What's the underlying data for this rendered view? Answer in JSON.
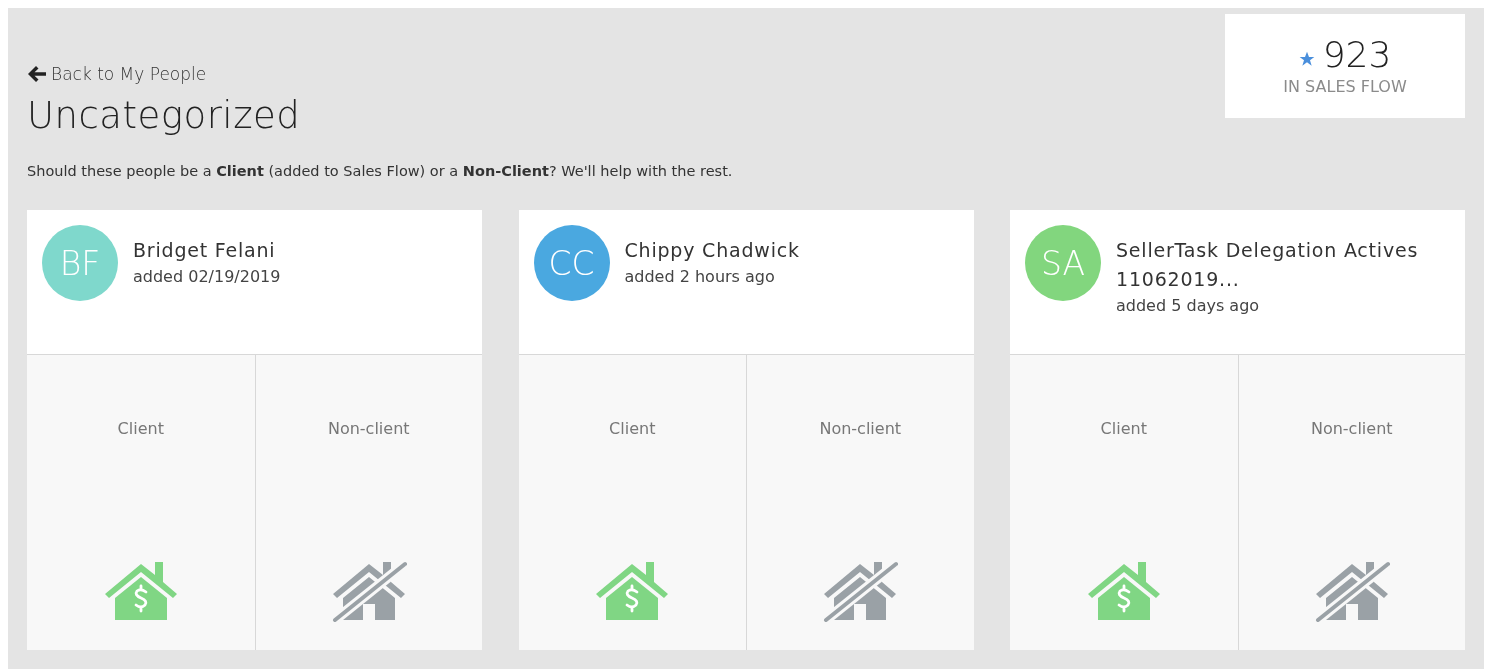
{
  "back_link": "Back to My People",
  "title": "Uncategorized",
  "intro": "Should these people be a **Client** (added to Sales Flow) or a **Non-Client**? We'll help with the rest.",
  "sales_flow": {
    "count": "923",
    "label": "IN SALES FLOW"
  },
  "people": [
    {
      "initials": "BF",
      "color": "#7fd8cc",
      "name": "Bridget Felani",
      "added": "added 02/19/2019",
      "options": [
        {
          "label": "Client",
          "kind": "client"
        },
        {
          "label": "Non-client",
          "kind": "non-client"
        }
      ]
    },
    {
      "initials": "CC",
      "color": "#4aa8e0",
      "name": "Chippy Chadwick",
      "added": "added 2 hours ago",
      "options": [
        {
          "label": "Client",
          "kind": "client"
        },
        {
          "label": "Non-client",
          "kind": "non-client"
        }
      ]
    },
    {
      "initials": "SA",
      "color": "#82d67e",
      "name": "SellerTask Delegation Actives 11062019...",
      "added": "added 5 days ago",
      "options": [
        {
          "label": "Client",
          "kind": "client"
        },
        {
          "label": "Non-client",
          "kind": "non-client"
        }
      ]
    }
  ]
}
